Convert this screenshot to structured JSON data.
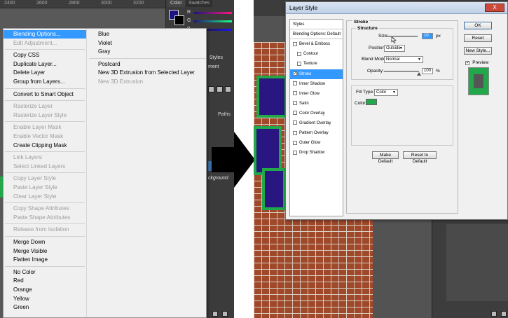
{
  "left": {
    "ruler_ticks": [
      "2400",
      "2600",
      "2800",
      "3000",
      "3200"
    ],
    "panel_tabs": [
      "Color",
      "Swatches"
    ],
    "panel_labels": [
      "R",
      "G",
      "B"
    ],
    "side_labels": [
      "Styles",
      "ment",
      "Paths"
    ],
    "menu_col1": [
      {
        "label": "Blending Options...",
        "state": "highlight"
      },
      {
        "label": "Edit Adjustment...",
        "state": "disabled"
      },
      {
        "label": "",
        "state": "sep"
      },
      {
        "label": "Copy CSS",
        "state": "normal"
      },
      {
        "label": "Duplicate Layer...",
        "state": "normal"
      },
      {
        "label": "Delete Layer",
        "state": "normal"
      },
      {
        "label": "Group from Layers...",
        "state": "normal"
      },
      {
        "label": "",
        "state": "sep"
      },
      {
        "label": "Convert to Smart Object",
        "state": "normal"
      },
      {
        "label": "",
        "state": "sep"
      },
      {
        "label": "Rasterize Layer",
        "state": "disabled"
      },
      {
        "label": "Rasterize Layer Style",
        "state": "disabled"
      },
      {
        "label": "",
        "state": "sep"
      },
      {
        "label": "Enable Layer Mask",
        "state": "disabled"
      },
      {
        "label": "Enable Vector Mask",
        "state": "disabled"
      },
      {
        "label": "Create Clipping Mask",
        "state": "normal"
      },
      {
        "label": "",
        "state": "sep"
      },
      {
        "label": "Link Layers",
        "state": "disabled"
      },
      {
        "label": "Select Linked Layers",
        "state": "disabled"
      },
      {
        "label": "",
        "state": "sep"
      },
      {
        "label": "Copy Layer Style",
        "state": "disabled"
      },
      {
        "label": "Paste Layer Style",
        "state": "disabled"
      },
      {
        "label": "Clear Layer Style",
        "state": "disabled"
      },
      {
        "label": "",
        "state": "sep"
      },
      {
        "label": "Copy Shape Attributes",
        "state": "disabled"
      },
      {
        "label": "Paste Shape Attributes",
        "state": "disabled"
      },
      {
        "label": "",
        "state": "sep"
      },
      {
        "label": "Release from Isolation",
        "state": "disabled"
      },
      {
        "label": "",
        "state": "sep"
      },
      {
        "label": "Merge Down",
        "state": "normal"
      },
      {
        "label": "Merge Visible",
        "state": "normal"
      },
      {
        "label": "Flatten Image",
        "state": "normal"
      },
      {
        "label": "",
        "state": "sep"
      },
      {
        "label": "No Color",
        "state": "normal"
      },
      {
        "label": "Red",
        "state": "normal"
      },
      {
        "label": "Orange",
        "state": "normal"
      },
      {
        "label": "Yellow",
        "state": "normal"
      },
      {
        "label": "Green",
        "state": "normal"
      }
    ],
    "menu_col2": [
      {
        "label": "Blue",
        "state": "normal"
      },
      {
        "label": "Violet",
        "state": "normal"
      },
      {
        "label": "Gray",
        "state": "normal"
      },
      {
        "label": "",
        "state": "sep"
      },
      {
        "label": "Postcard",
        "state": "normal"
      },
      {
        "label": "New 3D Extrusion from Selected Layer",
        "state": "normal"
      },
      {
        "label": "New 3D Extrusion",
        "state": "disabled"
      }
    ],
    "background_label": "ckground"
  },
  "dialog": {
    "title": "Layer Style",
    "close_label": "X",
    "styles_items": [
      {
        "label": "Styles",
        "kind": "head"
      },
      {
        "label": "Blending Options: Default",
        "kind": "head"
      },
      {
        "label": "Bevel & Emboss",
        "kind": "cb",
        "checked": false,
        "indent": false
      },
      {
        "label": "Contour",
        "kind": "cb",
        "checked": false,
        "indent": true
      },
      {
        "label": "Texture",
        "kind": "cb",
        "checked": false,
        "indent": true
      },
      {
        "label": "Stroke",
        "kind": "cb",
        "checked": true,
        "indent": false,
        "selected": true
      },
      {
        "label": "Inner Shadow",
        "kind": "cb",
        "checked": false,
        "indent": false
      },
      {
        "label": "Inner Glow",
        "kind": "cb",
        "checked": false,
        "indent": false
      },
      {
        "label": "Satin",
        "kind": "cb",
        "checked": false,
        "indent": false
      },
      {
        "label": "Color Overlay",
        "kind": "cb",
        "checked": false,
        "indent": false
      },
      {
        "label": "Gradient Overlay",
        "kind": "cb",
        "checked": false,
        "indent": false
      },
      {
        "label": "Pattern Overlay",
        "kind": "cb",
        "checked": false,
        "indent": false
      },
      {
        "label": "Outer Glow",
        "kind": "cb",
        "checked": false,
        "indent": false
      },
      {
        "label": "Drop Shadow",
        "kind": "cb",
        "checked": false,
        "indent": false
      }
    ],
    "stroke": {
      "title": "Stroke",
      "structure": "Structure",
      "size_label": "Size:",
      "size_value": "10",
      "size_unit": "px",
      "position_label": "Position:",
      "position_value": "Outside",
      "blend_label": "Blend Mode:",
      "blend_value": "Normal",
      "opacity_label": "Opacity:",
      "opacity_value": "100",
      "opacity_unit": "%",
      "fill_type_label": "Fill Type:",
      "fill_type_value": "Color",
      "color_label": "Color:",
      "stroke_color": "#22a84a",
      "make_default": "Make Default",
      "reset_default": "Reset to Default"
    },
    "buttons": {
      "ok": "OK",
      "reset": "Reset",
      "new_style": "New Style...",
      "preview_label": "Preview"
    }
  }
}
